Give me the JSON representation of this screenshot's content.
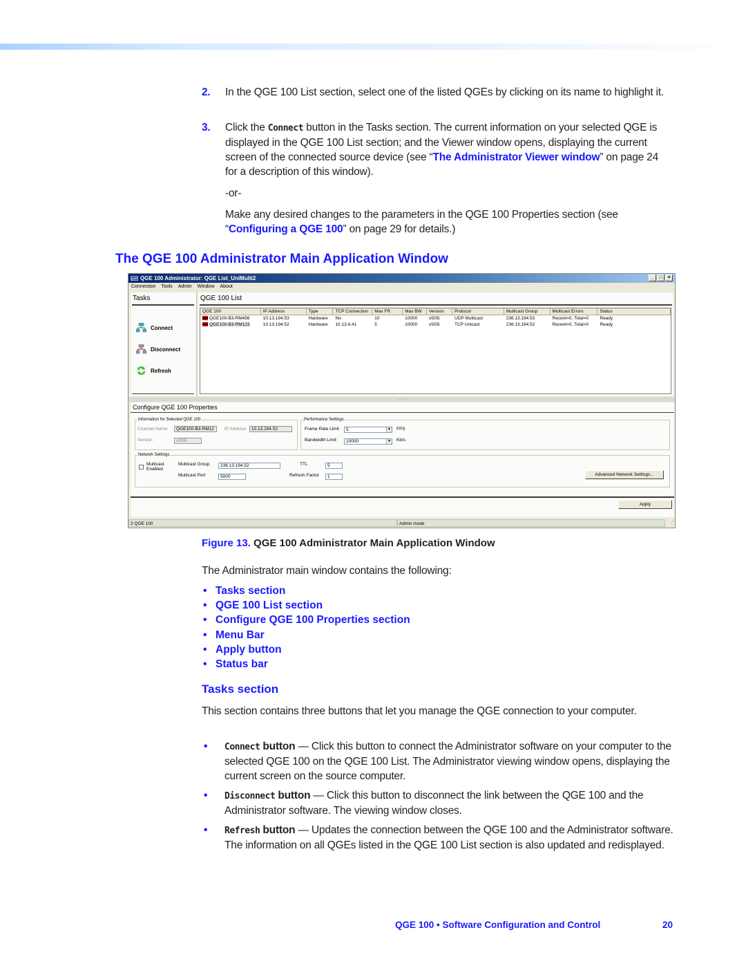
{
  "steps": [
    {
      "num": "2.",
      "text": "In the QGE 100 List section, select one of the listed QGEs by clicking on its name to highlight it."
    },
    {
      "num": "3.",
      "pre": "Click the ",
      "code": "Connect",
      "post1": " button in the Tasks section. The current information on your selected QGE is displayed in the QGE 100 List section; and the Viewer window opens, displaying the current screen of the connected source device (see “",
      "link": "The Administrator Viewer window",
      "post2": "” on page 24 for a description of this window).",
      "or": "-or-",
      "alt_pre": "Make any desired changes to the parameters in the QGE 100 Properties section (see “",
      "alt_link": "Configuring a QGE 100",
      "alt_post": "” on page 29 for details.)"
    }
  ],
  "section_heading": "The QGE 100 Administrator Main Application Window",
  "app": {
    "title": "QGE 100 Administrator: QGE List_UniMulti2",
    "icon_label": "QGE",
    "window_buttons": {
      "minimize": "_",
      "maximize": "□",
      "close": "×"
    },
    "menu": [
      "Connection",
      "Tools",
      "Admin",
      "Window",
      "About"
    ],
    "tasks": {
      "title": "Tasks",
      "buttons": [
        {
          "label": "Connect",
          "icon": "network-connect-icon"
        },
        {
          "label": "Disconnect",
          "icon": "network-disconnect-icon"
        },
        {
          "label": "Refresh",
          "icon": "refresh-icon"
        }
      ]
    },
    "list": {
      "title": "QGE 100 List",
      "columns": [
        "QGE 100",
        "IP Address",
        "Type",
        "TCP Connection",
        "Max FR",
        "Max BW",
        "Version",
        "Protocol",
        "Multicast Group",
        "Multicast Errors",
        "Status"
      ],
      "rows": [
        [
          "QGE100-B3-RM456",
          "10.13.194.53",
          "Hardware",
          "No",
          "10",
          "10000",
          "v505i",
          "UDP Multicast",
          "236.13.194.53",
          "Recent=0, Total=0",
          "Ready"
        ],
        [
          "QGE100-B3-RM123",
          "10.13.194.52",
          "Hardware",
          "10.13.4.41",
          "5",
          "10000",
          "v505i",
          "TCP Unicast",
          "236.13.194.52",
          "Recent=0, Total=0",
          "Ready"
        ]
      ]
    },
    "config": {
      "title": "Configure QGE 100 Properties",
      "info_group": "Information for Selected QGE 100",
      "channel_name_label": "Channel Name",
      "channel_name": "QGE100-B3-RM12",
      "ip_label": "IP Address",
      "ip": "10.13.194.52",
      "version_label": "Version",
      "version": "v505i",
      "perf_group": "Performance Settings",
      "frame_rate_label": "Frame Rate Limit",
      "frame_rate": "5",
      "frame_rate_unit": "FPS",
      "bandwidth_label": "Bandwidth Limit",
      "bandwidth": "10000",
      "bandwidth_unit": "Kb/s",
      "net_group": "Network Settings",
      "multicast_enabled_label": "Multicast Enabled",
      "multicast_group_label": "Multicast Group",
      "multicast_group": "236.13.194.52",
      "multicast_port_label": "Multicast Port",
      "multicast_port": "5000",
      "ttl_label": "TTL",
      "ttl": "5",
      "refresh_factor_label": "Refresh Factor",
      "refresh_factor": "1",
      "advanced_button": "Advanced Network Settings...",
      "apply_button": "Apply"
    },
    "status": {
      "count": "2 QGE 100",
      "mode": "Admin mode"
    }
  },
  "figure": {
    "label": "Figure 13.",
    "caption": " QGE 100 Administrator Main Application Window"
  },
  "intro": "The Administrator main window contains the following:",
  "contents_list": [
    "Tasks section",
    "QGE 100 List section",
    "Configure QGE 100 Properties section",
    "Menu Bar",
    "Apply button",
    "Status bar"
  ],
  "tasks_section": {
    "heading": "Tasks section",
    "intro": "This section contains three buttons that let you manage the QGE connection to your computer.",
    "items": [
      {
        "code": "Connect",
        "suffix": " button",
        "text": " — Click this button to connect the Administrator software on your computer to the selected QGE 100 on the QGE 100 List. The Administrator viewing window opens, displaying the current screen on the source computer."
      },
      {
        "code": "Disconnect",
        "suffix": " button",
        "text": " — Click this button to disconnect the link between the QGE 100 and the Administrator software. The viewing window closes."
      },
      {
        "code": "Refresh",
        "suffix": " button",
        "text": " — Updates the connection between the QGE 100 and the Administrator software. The information on all QGEs listed in the QGE 100 List section is also updated and redisplayed."
      }
    ]
  },
  "footer": {
    "title": "QGE 100 • Software Configuration and Control",
    "page": "20"
  }
}
